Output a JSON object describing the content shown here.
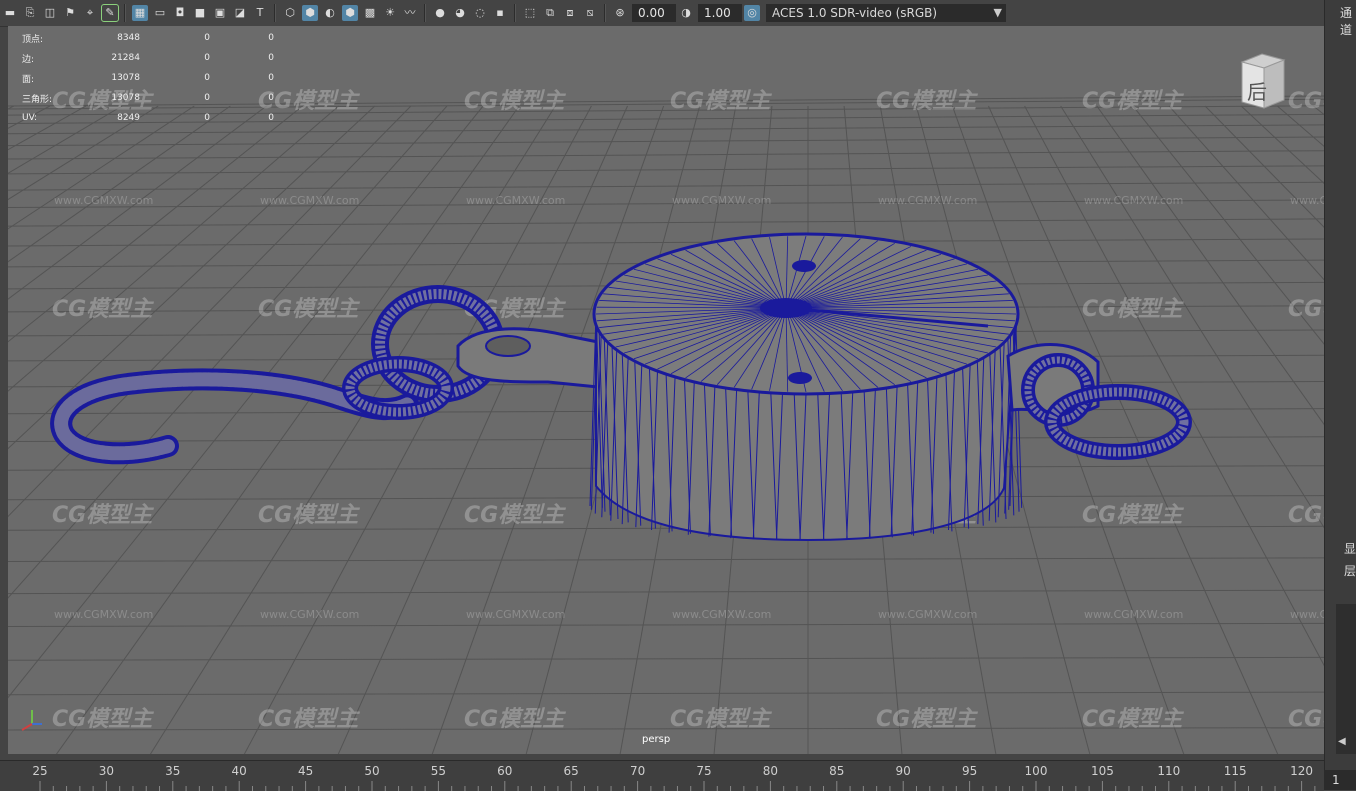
{
  "toolbar": {
    "exposure_value": "0.00",
    "gamma_value": "1.00",
    "color_space": "ACES 1.0 SDR-video (sRGB)",
    "icons": [
      "select-icon",
      "lasso-icon",
      "move-icon",
      "wireframe-icon",
      "shaded-icon",
      "textured-icon",
      "light-icon",
      "grid-icon",
      "camera-icon",
      "isolate-icon",
      "xray-icon",
      "exposure-icon",
      "gamma-icon"
    ]
  },
  "hud": {
    "rows": [
      {
        "label": "顶点:",
        "v1": "8348",
        "v2": "0",
        "v3": "0"
      },
      {
        "label": "边:",
        "v1": "21284",
        "v2": "0",
        "v3": "0"
      },
      {
        "label": "面:",
        "v1": "13078",
        "v2": "0",
        "v3": "0"
      },
      {
        "label": "三角形:",
        "v1": "13078",
        "v2": "0",
        "v3": "0"
      },
      {
        "label": "UV:",
        "v1": "8249",
        "v2": "0",
        "v3": "0"
      }
    ]
  },
  "viewport": {
    "camera": "persp",
    "viewcube_label": "后",
    "watermark_text": "CG模型主",
    "watermark_url": "www.CGMXW.com",
    "wireframe_color": "#1a1a9c",
    "grid_color": "#545454"
  },
  "right_panel": {
    "top_label": "通道",
    "label_a": "显",
    "label_b": "层"
  },
  "timeline": {
    "ticks": [
      "25",
      "30",
      "35",
      "40",
      "45",
      "50",
      "55",
      "60",
      "65",
      "70",
      "75",
      "80",
      "85",
      "90",
      "95",
      "100",
      "105",
      "110",
      "115",
      "120"
    ],
    "current_frame": "1"
  }
}
